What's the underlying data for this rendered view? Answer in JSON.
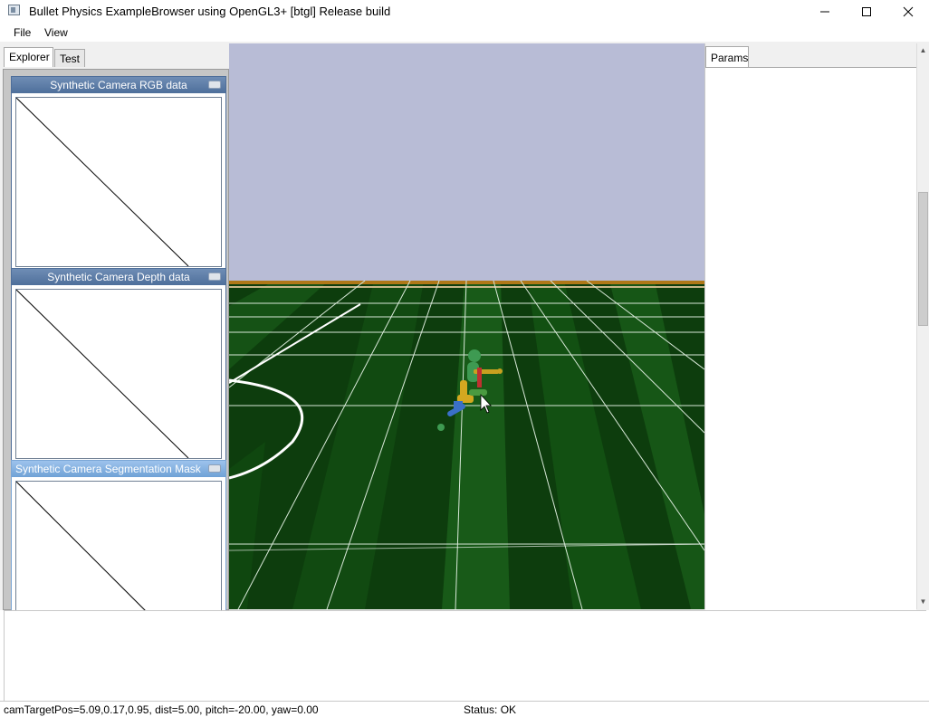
{
  "window": {
    "title": "Bullet Physics ExampleBrowser using OpenGL3+ [btgl] Release build",
    "minimize_icon": "minimize-icon",
    "maximize_icon": "maximize-icon",
    "close_icon": "close-icon"
  },
  "menu": {
    "file": "File",
    "view": "View"
  },
  "tabs": {
    "explorer": "Explorer",
    "test": "Test",
    "params": "Params"
  },
  "camera_windows": [
    {
      "title": "Synthetic Camera RGB data"
    },
    {
      "title": "Synthetic Camera Depth data"
    },
    {
      "title": "Synthetic Camera Segmentation Mask"
    }
  ],
  "status": {
    "camera": "camTargetPos=5.09,0.17,0.95, dist=5.00, pitch=-20.00, yaw=0.00",
    "state": "Status: OK"
  },
  "colors": {
    "sky": "#b8bcd6",
    "grass_dark": "#0c3a0c",
    "grass_light": "#195e19",
    "title_active": "#6fa1d6",
    "title_inactive": "#4e6f9b"
  }
}
